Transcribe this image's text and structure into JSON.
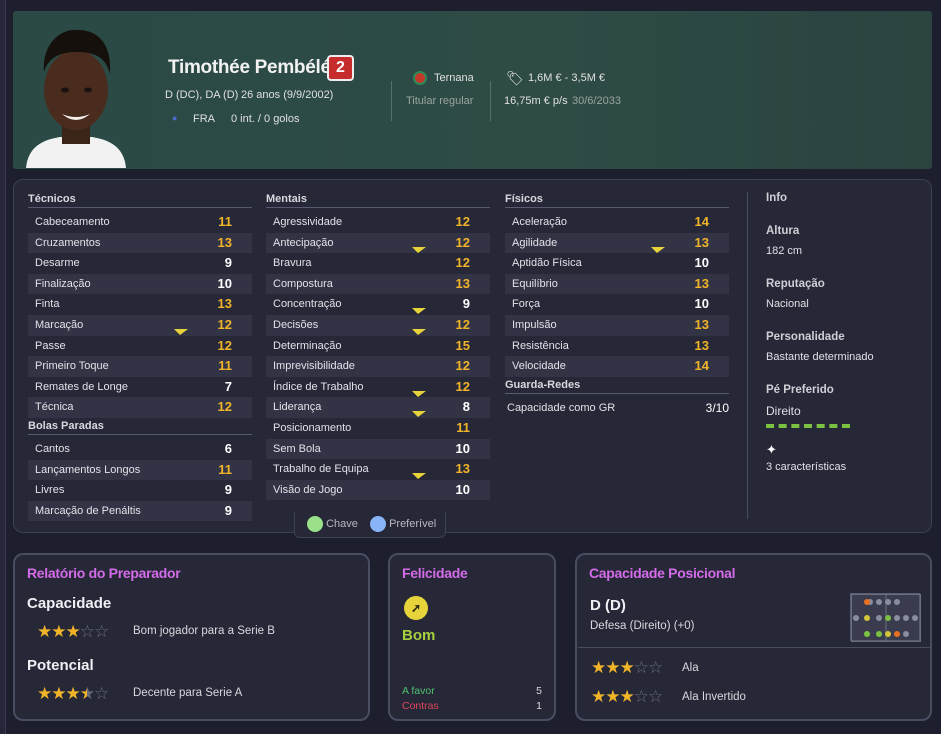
{
  "player": {
    "name": "Timothée Pembélé",
    "number": "2",
    "positions": "D (DC), DA (D)",
    "age": "26 anos (9/9/2002)",
    "nationality": "FRA",
    "caps": "0 int. / 0 golos",
    "club": "Ternana",
    "squad_status": "Titular regular",
    "value": "1,6M € - 3,5M €",
    "wage": "16,75m € p/s",
    "contract_end": "30/6/2033"
  },
  "attributes": {
    "tecnicos": {
      "title": "Técnicos",
      "rows": [
        {
          "label": "Cabeceamento",
          "value": "11",
          "color": "y"
        },
        {
          "label": "Cruzamentos",
          "value": "13",
          "color": "y"
        },
        {
          "label": "Desarme",
          "value": "9",
          "color": "w"
        },
        {
          "label": "Finalização",
          "value": "10",
          "color": "w"
        },
        {
          "label": "Finta",
          "value": "13",
          "color": "y"
        },
        {
          "label": "Marcação",
          "value": "12",
          "color": "y",
          "flag": true
        },
        {
          "label": "Passe",
          "value": "12",
          "color": "y"
        },
        {
          "label": "Primeiro Toque",
          "value": "11",
          "color": "y"
        },
        {
          "label": "Remates de Longe",
          "value": "7",
          "color": "w"
        },
        {
          "label": "Técnica",
          "value": "12",
          "color": "y"
        }
      ]
    },
    "bolas_paradas": {
      "title": "Bolas Paradas",
      "rows": [
        {
          "label": "Cantos",
          "value": "6",
          "color": "w"
        },
        {
          "label": "Lançamentos Longos",
          "value": "11",
          "color": "y"
        },
        {
          "label": "Livres",
          "value": "9",
          "color": "w"
        },
        {
          "label": "Marcação de Penáltis",
          "value": "9",
          "color": "w"
        }
      ]
    },
    "mentais": {
      "title": "Mentais",
      "rows": [
        {
          "label": "Agressividade",
          "value": "12",
          "color": "y"
        },
        {
          "label": "Antecipação",
          "value": "12",
          "color": "y",
          "flag": true
        },
        {
          "label": "Bravura",
          "value": "12",
          "color": "y"
        },
        {
          "label": "Compostura",
          "value": "13",
          "color": "y"
        },
        {
          "label": "Concentração",
          "value": "9",
          "color": "w",
          "flag": true
        },
        {
          "label": "Decisões",
          "value": "12",
          "color": "y",
          "flag": true
        },
        {
          "label": "Determinação",
          "value": "15",
          "color": "y"
        },
        {
          "label": "Imprevisibilidade",
          "value": "12",
          "color": "y"
        },
        {
          "label": "Índice de Trabalho",
          "value": "12",
          "color": "y",
          "flag": true
        },
        {
          "label": "Liderança",
          "value": "8",
          "color": "w",
          "flag": true
        },
        {
          "label": "Posicionamento",
          "value": "11",
          "color": "y"
        },
        {
          "label": "Sem Bola",
          "value": "10",
          "color": "w"
        },
        {
          "label": "Trabalho de Equipa",
          "value": "13",
          "color": "y",
          "flag": true
        },
        {
          "label": "Visão de Jogo",
          "value": "10",
          "color": "w"
        }
      ]
    },
    "fisicos": {
      "title": "Físicos",
      "rows": [
        {
          "label": "Aceleração",
          "value": "14",
          "color": "y"
        },
        {
          "label": "Agilidade",
          "value": "13",
          "color": "y",
          "flag": true
        },
        {
          "label": "Aptidão Física",
          "value": "10",
          "color": "w"
        },
        {
          "label": "Equilíbrio",
          "value": "13",
          "color": "y"
        },
        {
          "label": "Força",
          "value": "10",
          "color": "w"
        },
        {
          "label": "Impulsão",
          "value": "13",
          "color": "y"
        },
        {
          "label": "Resistência",
          "value": "13",
          "color": "y"
        },
        {
          "label": "Velocidade",
          "value": "14",
          "color": "y"
        }
      ]
    },
    "guarda_redes": {
      "title": "Guarda-Redes",
      "label": "Capacidade como GR",
      "value": "3/10"
    }
  },
  "info": {
    "title": "Info",
    "height_label": "Altura",
    "height": "182 cm",
    "rep_label": "Reputação",
    "rep": "Nacional",
    "pers_label": "Personalidade",
    "pers": "Bastante determinado",
    "foot_label": "Pé Preferido",
    "foot": "Direito",
    "traits": "3 características"
  },
  "legend": {
    "key": "Chave",
    "preferred": "Preferível"
  },
  "report": {
    "title": "Relatório do Preparador",
    "cap_label": "Capacidade",
    "cap_stars": 3,
    "cap_text": "Bom jogador para a Serie B",
    "pot_label": "Potencial",
    "pot_stars": 3.5,
    "pot_text": "Decente para Serie A"
  },
  "happiness": {
    "title": "Felicidade",
    "status": "Bom",
    "for_label": "A favor",
    "for_count": "5",
    "against_label": "Contras",
    "against_count": "1"
  },
  "positional": {
    "title": "Capacidade Posicional",
    "position": "D (D)",
    "desc": "Defesa (Direito) (+0)",
    "role1": "Ala",
    "role1_stars": 3,
    "role2": "Ala Invertido",
    "role2_stars": 3
  },
  "colors": {
    "accent": "#d46be8",
    "yellow": "#f0b429",
    "green": "#7cc242",
    "key": "#9be08a",
    "pref": "#8ab4f8"
  }
}
